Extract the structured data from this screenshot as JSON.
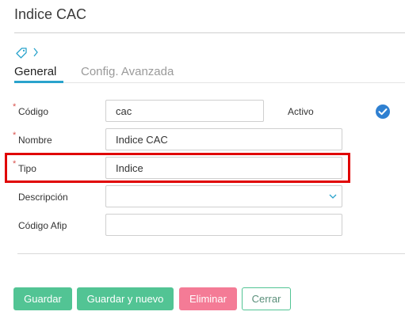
{
  "page": {
    "title": "Indice CAC"
  },
  "tabs": [
    {
      "label": "General",
      "active": true
    },
    {
      "label": "Config. Avanzada",
      "active": false
    }
  ],
  "form": {
    "required_marker": "*",
    "codigo": {
      "label": "Código",
      "value": "cac",
      "required": true
    },
    "activo": {
      "label": "Activo",
      "checked": true
    },
    "nombre": {
      "label": "Nombre",
      "value": "Indice CAC",
      "required": true
    },
    "tipo": {
      "label": "Tipo",
      "value": "Indice",
      "required": true
    },
    "descripcion": {
      "label": "Descripción",
      "value": ""
    },
    "codigo_afip": {
      "label": "Código Afip",
      "value": ""
    }
  },
  "buttons": {
    "guardar": "Guardar",
    "guardar_nuevo": "Guardar y nuevo",
    "eliminar": "Eliminar",
    "cerrar": "Cerrar"
  },
  "icons": {
    "tag": "tag-icon",
    "chevron": "chevron-right-icon",
    "check": "check-circle-icon",
    "select": "chevron-down-icon"
  },
  "colors": {
    "accent": "#2aa3cc",
    "primary_button": "#52c494",
    "danger_button": "#f47b96",
    "check": "#2f80d1",
    "highlight": "#e00000",
    "required": "#d9534f"
  }
}
